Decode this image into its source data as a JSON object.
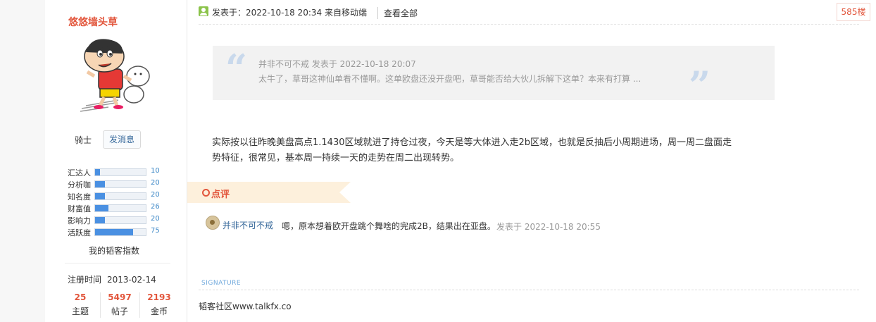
{
  "sidebar": {
    "username": "悠悠墙头草",
    "rank": "骑士",
    "message_button": "发消息",
    "stats": [
      {
        "label": "汇达人",
        "value": "10",
        "percent": 10
      },
      {
        "label": "分析咖",
        "value": "20",
        "percent": 20
      },
      {
        "label": "知名度",
        "value": "20",
        "percent": 20
      },
      {
        "label": "财富值",
        "value": "26",
        "percent": 26
      },
      {
        "label": "影响力",
        "value": "20",
        "percent": 20
      },
      {
        "label": "活跃度",
        "value": "75",
        "percent": 75
      }
    ],
    "index_link": "我的韬客指数",
    "register_label": "注册时间",
    "register_date": "2013-02-14",
    "counts": [
      {
        "num": "25",
        "label": "主题"
      },
      {
        "num": "5497",
        "label": "帖子"
      },
      {
        "num": "2193",
        "label": "金币"
      }
    ]
  },
  "post": {
    "posted_text": "发表于：2022-10-18 20:34  来自移动端",
    "view_all": "查看全部",
    "floor": "585楼",
    "quote": {
      "meta": "并非不可不戒 发表于 2022-10-18 20:07",
      "text": "太牛了，草哥这神仙单看不懂啊。这单欧盘还没开盘吧，草哥能否给大伙儿拆解下这单？本来有打算 ..."
    },
    "content_line1": "实际按以往昨晚美盘高点1.1430区域就进了持仓过夜，今天是等大体进入走2b区域，也就是反抽后小周期进场，周一周二盘面走",
    "content_line2": "势特征，很常见，基本周一持续一天的走势在周二出现转势。"
  },
  "comments_section": {
    "title": "点评",
    "items": [
      {
        "user": "并非不可不戒",
        "text": "嗯，原本想着欧开盘跳个舞啥的完成2B，结果出在亚盘。",
        "time": "发表于 2022-10-18 20:55"
      }
    ]
  },
  "signature": {
    "label": "SIGNATURE",
    "text": "韬客社区www.talkfx.co"
  },
  "colors": {
    "accent": "#e2553b",
    "link": "#336699",
    "bar": "#4a90e2",
    "quote_bg": "#f2f2f2",
    "comment_tab_bg": "#fdf0dc"
  }
}
